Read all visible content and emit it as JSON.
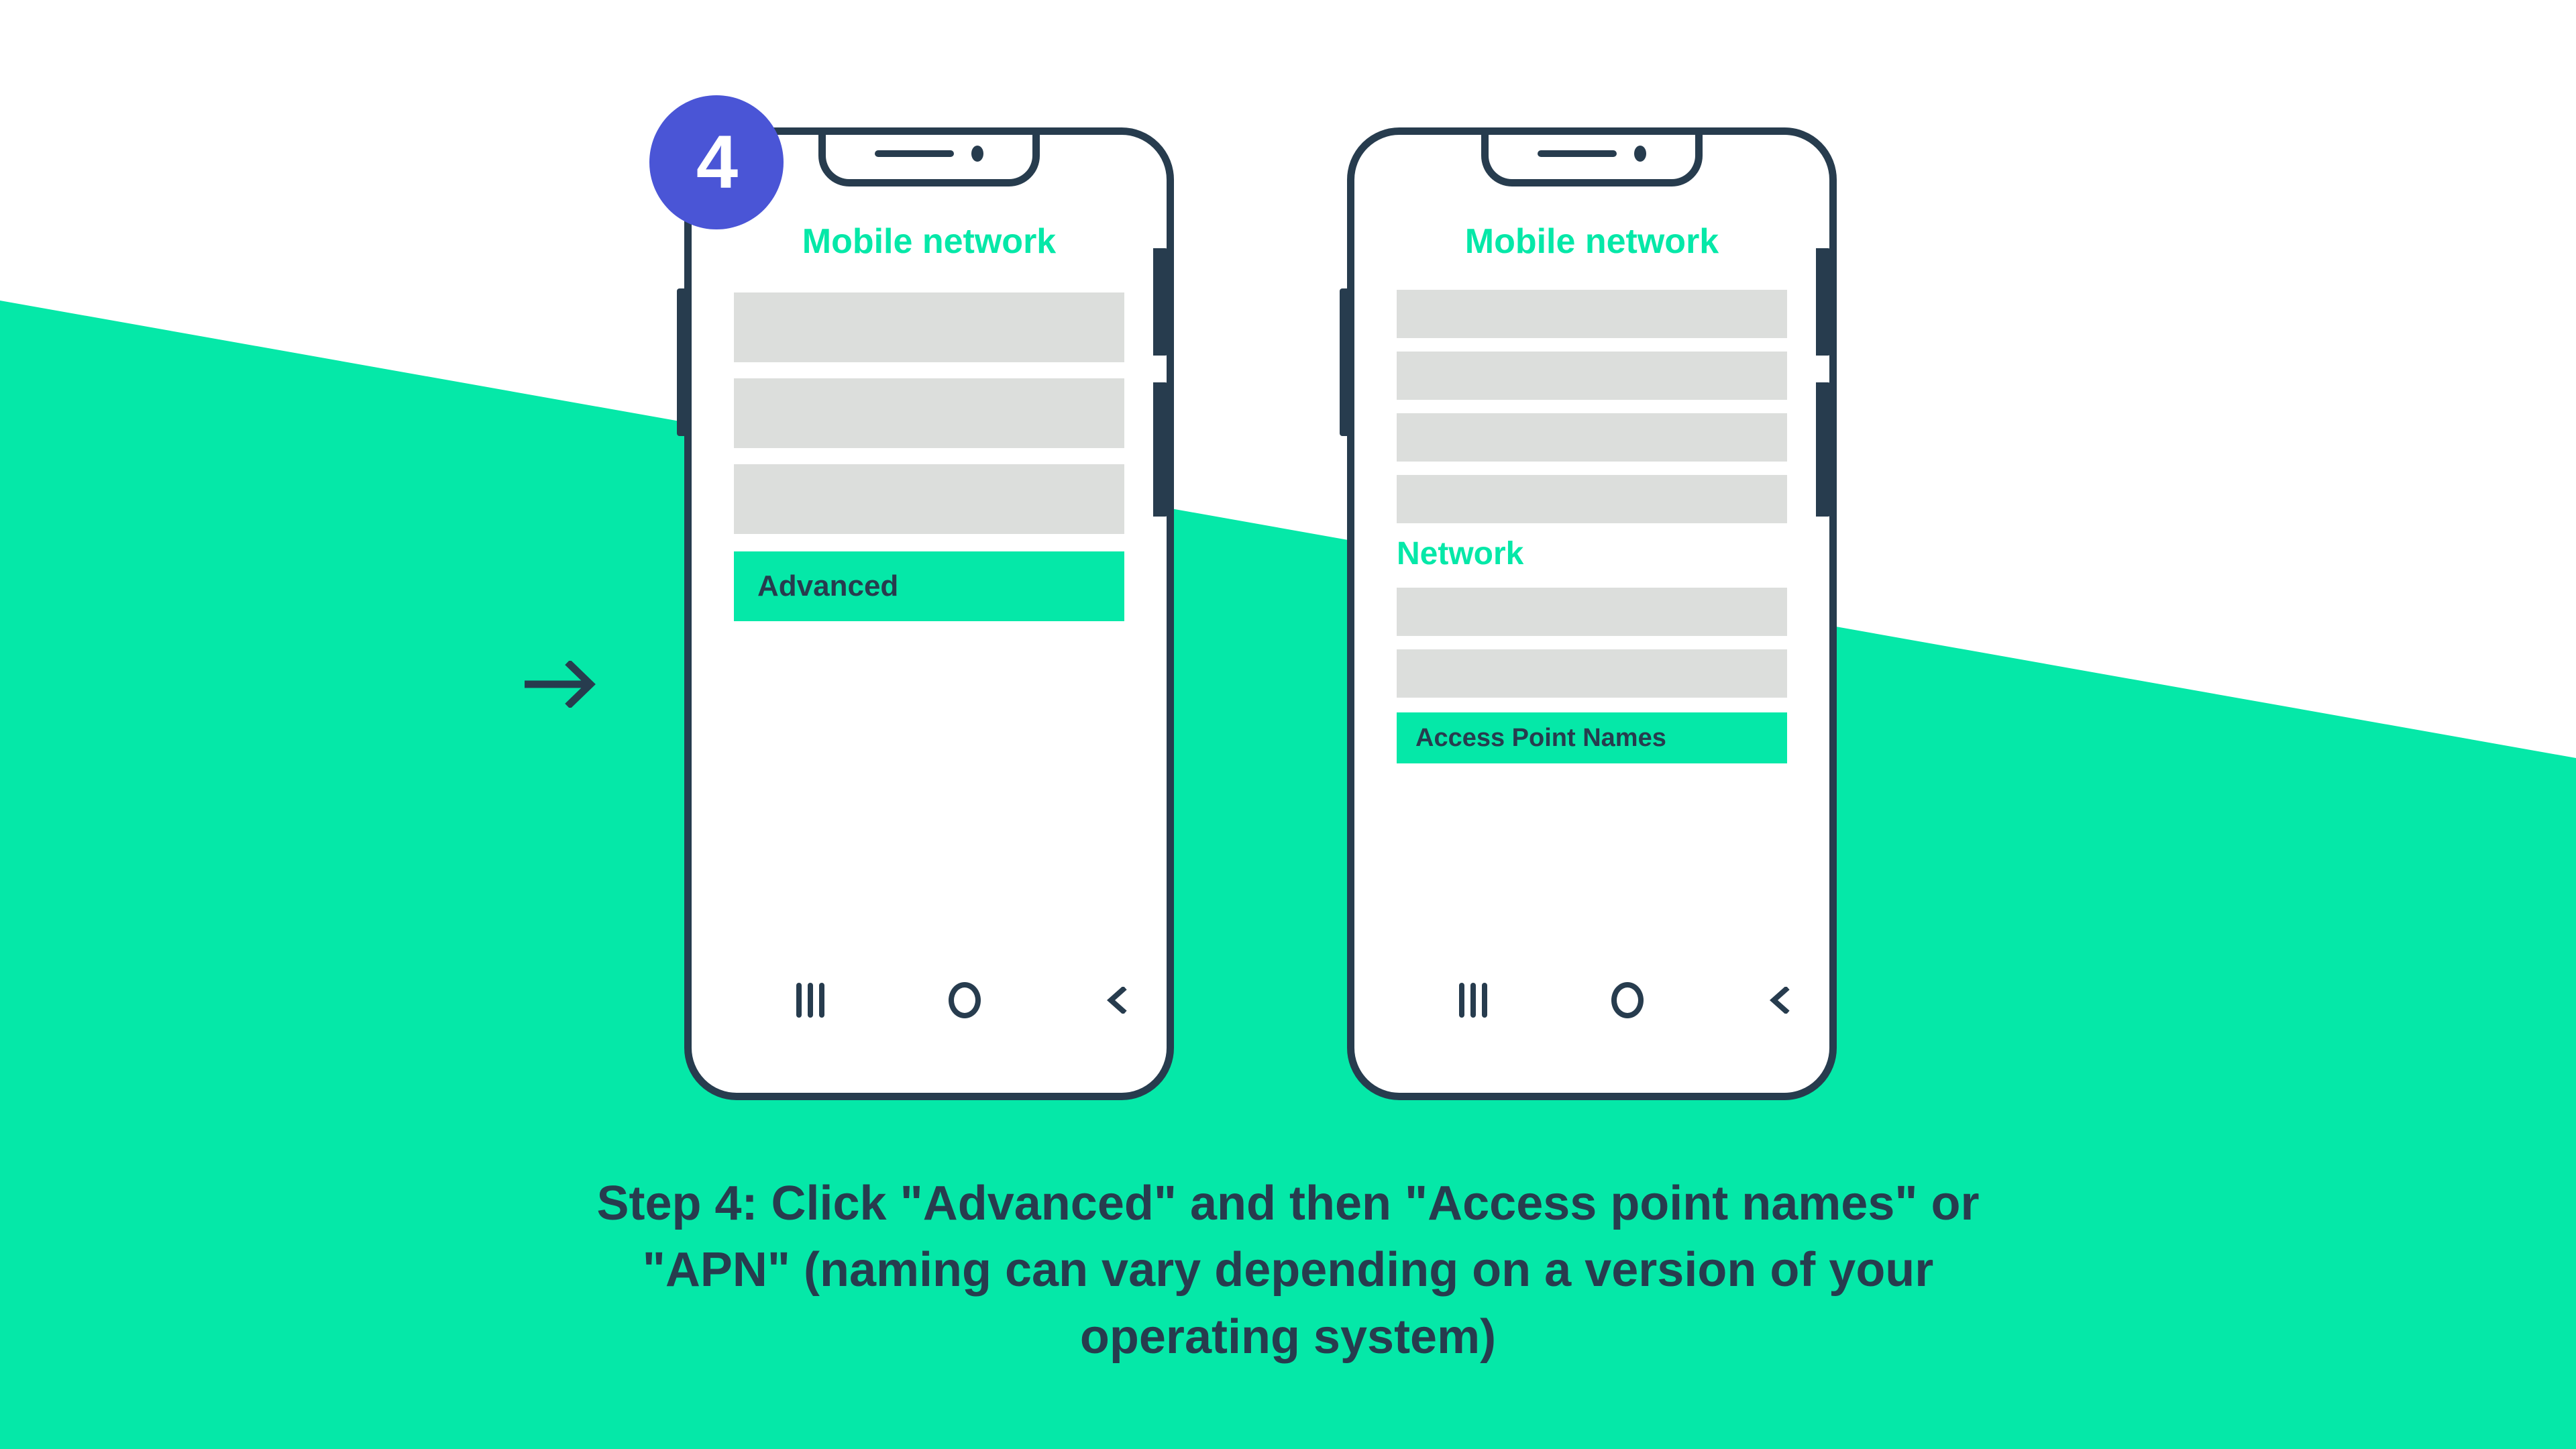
{
  "colors": {
    "accent_green": "#05e8a8",
    "dark_navy": "#273c4e",
    "badge_purple": "#4a55d6",
    "placeholder_gray": "#dcdedc",
    "background_white": "#ffffff"
  },
  "step": {
    "badge_number": "4",
    "caption": "Step 4: Click \"Advanced\" and then \"Access point names\" or \"APN\" (naming can vary depending on a version of your operating system)"
  },
  "transition": {
    "arrow_icon": "arrow-right-icon"
  },
  "phones": [
    {
      "id": "phone-before",
      "screen_title": "Mobile network",
      "items": [
        {
          "type": "placeholder",
          "label": ""
        },
        {
          "type": "placeholder",
          "label": ""
        },
        {
          "type": "placeholder",
          "label": ""
        },
        {
          "type": "highlight",
          "label": "Advanced"
        }
      ],
      "navbar": {
        "recents_label": "recents-icon",
        "home_label": "home-icon",
        "back_label": "back-icon"
      }
    },
    {
      "id": "phone-after",
      "screen_title": "Mobile network",
      "items": [
        {
          "type": "placeholder",
          "label": ""
        },
        {
          "type": "placeholder",
          "label": ""
        },
        {
          "type": "placeholder",
          "label": ""
        },
        {
          "type": "placeholder",
          "label": ""
        },
        {
          "type": "heading",
          "label": "Network"
        },
        {
          "type": "placeholder",
          "label": ""
        },
        {
          "type": "placeholder",
          "label": ""
        },
        {
          "type": "highlight",
          "label": "Access Point Names"
        }
      ],
      "navbar": {
        "recents_label": "recents-icon",
        "home_label": "home-icon",
        "back_label": "back-icon"
      }
    }
  ]
}
